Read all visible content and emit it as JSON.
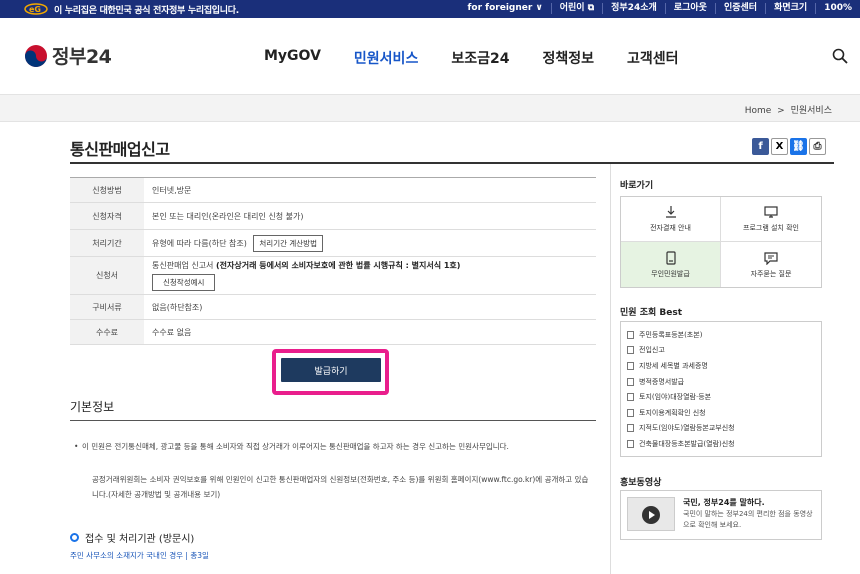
{
  "govbar": {
    "notice": "이 누리집은 대한민국 공식 전자정부 누리집입니다.",
    "links": [
      "for foreigner ∨",
      "어린이 ⧉",
      "정부24소개",
      "로그아웃",
      "인증센터",
      "화면크기",
      "100%"
    ]
  },
  "header": {
    "logo_text": "정부24",
    "nav": [
      "MyGOV",
      "민원서비스",
      "보조금24",
      "정책정보",
      "고객센터"
    ],
    "active_nav": "민원서비스"
  },
  "breadcrumb": {
    "home": "Home",
    "sep": ">",
    "current": "민원서비스"
  },
  "page": {
    "title": "통신판매업신고"
  },
  "info": {
    "method_label": "신청방법",
    "method_value": "인터넷,방문",
    "qual_label": "신청자격",
    "qual_value": "본인 또는 대리인(온라인은 대리인 신청 불가)",
    "period_label": "처리기간",
    "period_value": "유형에 따라 다름(하단 참조)",
    "period_btn": "처리기간 계산방법",
    "form_label": "신청서",
    "form_value": "통신판매업 신고서",
    "form_bold": "(전자상거래 등에서의 소비자보호에 관한 법률 시행규칙 : 별지서식 1호)",
    "form_btn": "신청작성예시",
    "docs_label": "구비서류",
    "docs_value": "없음(하단참조)",
    "fee_label": "수수료",
    "fee_value": "수수료 없음"
  },
  "issue_button": "발급하기",
  "basic": {
    "title": "기본정보",
    "p1": "이 민원은 전기통신매체, 광고물 등을 통해 소비자와 직접 상거래가 이루어지는 통신판매업을 하고자 하는 경우 신고하는 민원사무입니다.",
    "p2": "공정거래위원회는 소비자 권익보호를 위해 민원인이 신고한 통신판매업자의 신원정보(전화번호, 주소 등)를 위원회 홈페이지(www.ftc.go.kr)에 공개하고 있습니다.(자세한 공개방법 및 공개내용 보기)",
    "sub_title": "접수 및 처리기관 (방문시)",
    "sub_note": "주민 사무소의 소재지가 국내인 경우 | 총3일"
  },
  "sidebar": {
    "quick_title": "바로가기",
    "quick": [
      {
        "label": "전자결재 안내",
        "icon": "download-icon"
      },
      {
        "label": "프로그램 설치 확인",
        "icon": "monitor-icon"
      },
      {
        "label": "무인민원발급",
        "icon": "kiosk-icon"
      },
      {
        "label": "자주묻는 질문",
        "icon": "faq-icon"
      }
    ],
    "best_title": "민원 조회 Best",
    "best": [
      "주민등록표등본(초본)",
      "전입신고",
      "지방세 세목별 과세증명",
      "병적증명서발급",
      "토지(임야)대장열람·등본",
      "토지이용계획확인 신청",
      "지적도(임야도)열람등본교부신청",
      "건축물대장등초본발급(열람)신청"
    ],
    "promo_title": "홍보동영상",
    "promo_head": "국민, 정부24를 말하다.",
    "promo_desc": "국민이 말하는 정부24의 편리한 점을 동영상으로 확인해 보세요."
  }
}
